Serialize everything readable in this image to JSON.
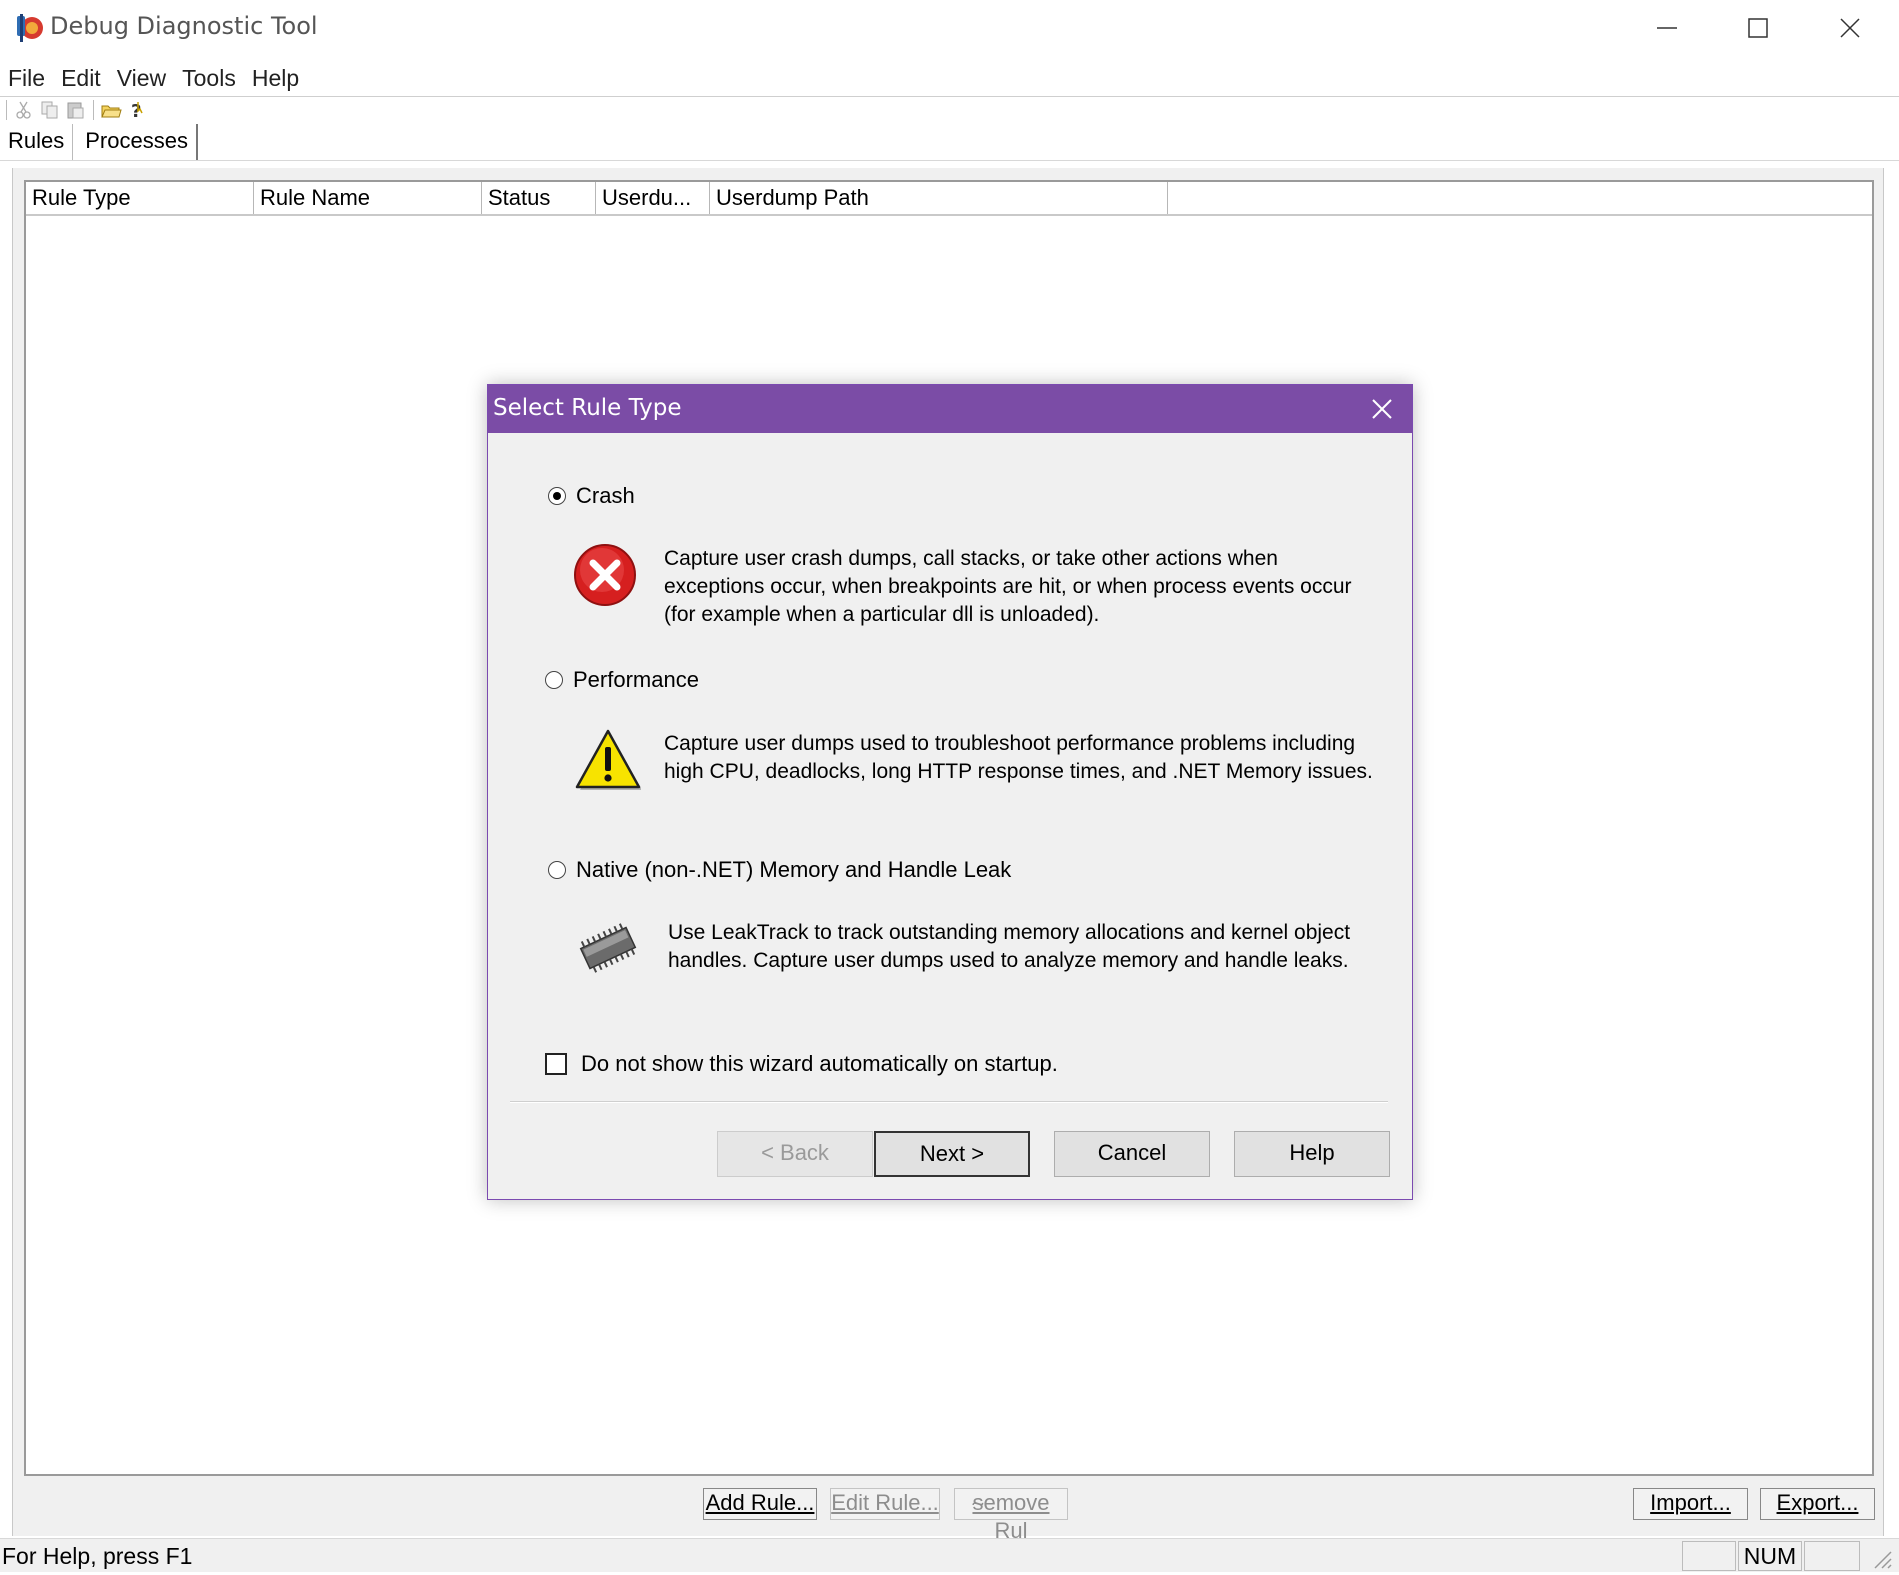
{
  "window": {
    "title": "Debug Diagnostic Tool"
  },
  "menu": [
    "File",
    "Edit",
    "View",
    "Tools",
    "Help"
  ],
  "toolbar": {
    "icons": [
      "cut-icon",
      "copy-icon",
      "paste-icon",
      "open-folder-icon",
      "help-pointer-icon"
    ]
  },
  "tabs": [
    {
      "label": "Rules",
      "active": true
    },
    {
      "label": "Processes",
      "active": false
    }
  ],
  "rules_list": {
    "columns": [
      "Rule Type",
      "Rule Name",
      "Status",
      "Userdu...",
      "Userdump Path"
    ],
    "rows": []
  },
  "bottom_buttons": {
    "add_rule": "Add Rule...",
    "edit_rule": "Edit Rule...",
    "remove_rule": "ᵴemove Rul",
    "import": "Import...",
    "export": "Export..."
  },
  "status_bar": {
    "help_text": "For Help, press F1",
    "num": "NUM"
  },
  "dialog": {
    "title": "Select Rule Type",
    "accent_color": "#7b4ca6",
    "options": [
      {
        "label": "Crash",
        "checked": true,
        "icon": "error-icon",
        "description": "Capture user crash dumps, call stacks, or take other actions when exceptions occur, when breakpoints are hit, or when process events occur (for example when a particular dll is unloaded)."
      },
      {
        "label": "Performance",
        "checked": false,
        "icon": "warning-icon",
        "description": "Capture user dumps used to troubleshoot performance problems including high CPU, deadlocks, long HTTP response times, and .NET Memory issues."
      },
      {
        "label": "Native (non-.NET) Memory and Handle Leak",
        "checked": false,
        "icon": "memory-chip-icon",
        "description": "Use LeakTrack to track outstanding memory allocations and kernel object handles. Capture user dumps used to analyze memory and handle leaks."
      }
    ],
    "checkbox_label": "Do not show this wizard automatically on startup.",
    "checkbox_checked": false,
    "buttons": {
      "back": "< Back",
      "next": "Next >",
      "cancel": "Cancel",
      "help": "Help"
    }
  }
}
